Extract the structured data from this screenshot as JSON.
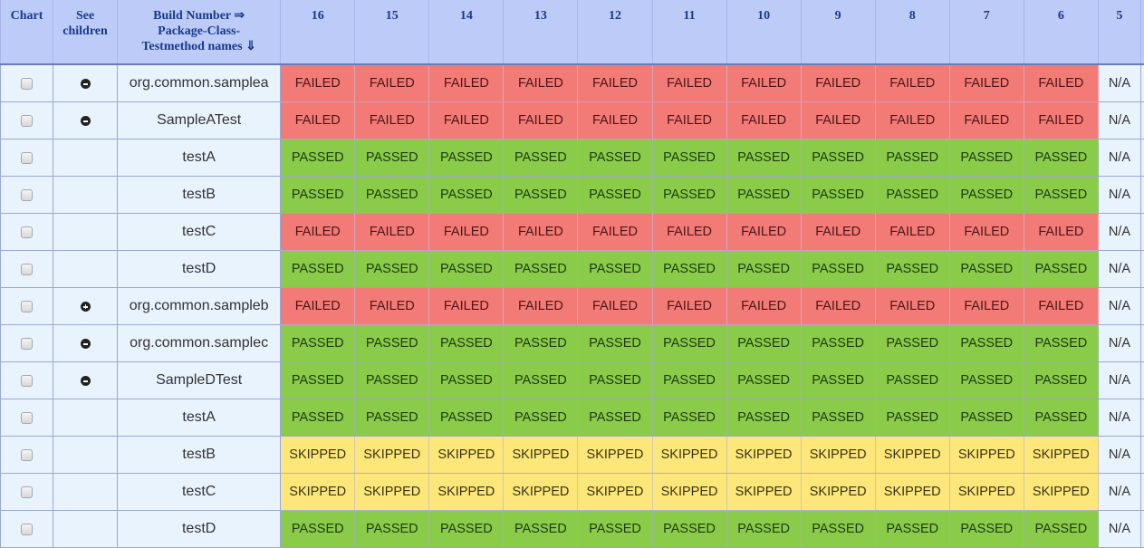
{
  "header": {
    "chart": "Chart",
    "see_children": "See children",
    "names_line1": "Build Number ⇒",
    "names_line2": "Package-Class-",
    "names_line3": "Testmethod names ⇓",
    "builds": [
      "16",
      "15",
      "14",
      "13",
      "12",
      "11",
      "10",
      "9",
      "8",
      "7",
      "6",
      "5"
    ]
  },
  "rows": [
    {
      "name": "org.common.samplea",
      "indent": 0,
      "toggle": "minus",
      "statuses": [
        "FAILED",
        "FAILED",
        "FAILED",
        "FAILED",
        "FAILED",
        "FAILED",
        "FAILED",
        "FAILED",
        "FAILED",
        "FAILED",
        "FAILED",
        "N/A"
      ]
    },
    {
      "name": "SampleATest",
      "indent": 1,
      "toggle": "minus",
      "statuses": [
        "FAILED",
        "FAILED",
        "FAILED",
        "FAILED",
        "FAILED",
        "FAILED",
        "FAILED",
        "FAILED",
        "FAILED",
        "FAILED",
        "FAILED",
        "N/A"
      ]
    },
    {
      "name": "testA",
      "indent": 2,
      "toggle": "",
      "statuses": [
        "PASSED",
        "PASSED",
        "PASSED",
        "PASSED",
        "PASSED",
        "PASSED",
        "PASSED",
        "PASSED",
        "PASSED",
        "PASSED",
        "PASSED",
        "N/A"
      ]
    },
    {
      "name": "testB",
      "indent": 2,
      "toggle": "",
      "statuses": [
        "PASSED",
        "PASSED",
        "PASSED",
        "PASSED",
        "PASSED",
        "PASSED",
        "PASSED",
        "PASSED",
        "PASSED",
        "PASSED",
        "PASSED",
        "N/A"
      ]
    },
    {
      "name": "testC",
      "indent": 2,
      "toggle": "",
      "statuses": [
        "FAILED",
        "FAILED",
        "FAILED",
        "FAILED",
        "FAILED",
        "FAILED",
        "FAILED",
        "FAILED",
        "FAILED",
        "FAILED",
        "FAILED",
        "N/A"
      ]
    },
    {
      "name": "testD",
      "indent": 2,
      "toggle": "",
      "statuses": [
        "PASSED",
        "PASSED",
        "PASSED",
        "PASSED",
        "PASSED",
        "PASSED",
        "PASSED",
        "PASSED",
        "PASSED",
        "PASSED",
        "PASSED",
        "N/A"
      ]
    },
    {
      "name": "org.common.sampleb",
      "indent": 0,
      "toggle": "plus",
      "statuses": [
        "FAILED",
        "FAILED",
        "FAILED",
        "FAILED",
        "FAILED",
        "FAILED",
        "FAILED",
        "FAILED",
        "FAILED",
        "FAILED",
        "FAILED",
        "N/A"
      ]
    },
    {
      "name": "org.common.samplec",
      "indent": 0,
      "toggle": "minus",
      "statuses": [
        "PASSED",
        "PASSED",
        "PASSED",
        "PASSED",
        "PASSED",
        "PASSED",
        "PASSED",
        "PASSED",
        "PASSED",
        "PASSED",
        "PASSED",
        "N/A"
      ]
    },
    {
      "name": "SampleDTest",
      "indent": 1,
      "toggle": "minus",
      "statuses": [
        "PASSED",
        "PASSED",
        "PASSED",
        "PASSED",
        "PASSED",
        "PASSED",
        "PASSED",
        "PASSED",
        "PASSED",
        "PASSED",
        "PASSED",
        "N/A"
      ]
    },
    {
      "name": "testA",
      "indent": 2,
      "toggle": "",
      "statuses": [
        "PASSED",
        "PASSED",
        "PASSED",
        "PASSED",
        "PASSED",
        "PASSED",
        "PASSED",
        "PASSED",
        "PASSED",
        "PASSED",
        "PASSED",
        "N/A"
      ]
    },
    {
      "name": "testB",
      "indent": 2,
      "toggle": "",
      "statuses": [
        "SKIPPED",
        "SKIPPED",
        "SKIPPED",
        "SKIPPED",
        "SKIPPED",
        "SKIPPED",
        "SKIPPED",
        "SKIPPED",
        "SKIPPED",
        "SKIPPED",
        "SKIPPED",
        "N/A"
      ]
    },
    {
      "name": "testC",
      "indent": 2,
      "toggle": "",
      "statuses": [
        "SKIPPED",
        "SKIPPED",
        "SKIPPED",
        "SKIPPED",
        "SKIPPED",
        "SKIPPED",
        "SKIPPED",
        "SKIPPED",
        "SKIPPED",
        "SKIPPED",
        "SKIPPED",
        "N/A"
      ]
    },
    {
      "name": "testD",
      "indent": 2,
      "toggle": "",
      "statuses": [
        "PASSED",
        "PASSED",
        "PASSED",
        "PASSED",
        "PASSED",
        "PASSED",
        "PASSED",
        "PASSED",
        "PASSED",
        "PASSED",
        "PASSED",
        "N/A"
      ]
    }
  ],
  "colors": {
    "failed": "#f37b77",
    "passed": "#8bcb4a",
    "skipped": "#fde67a",
    "na": "#e8f3fe",
    "header": "#bccbf8"
  }
}
